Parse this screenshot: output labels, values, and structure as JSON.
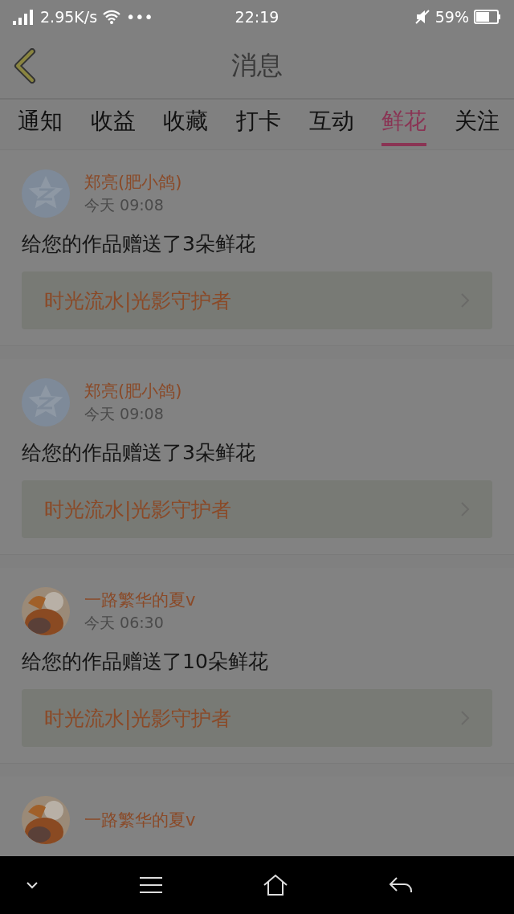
{
  "status_bar": {
    "speed": "2.95K/s",
    "more": "•••",
    "time": "22:19",
    "battery": "59%"
  },
  "header": {
    "title": "消息"
  },
  "tabs": [
    {
      "label": "通知",
      "selected": false
    },
    {
      "label": "收益",
      "selected": false
    },
    {
      "label": "收藏",
      "selected": false
    },
    {
      "label": "打卡",
      "selected": false
    },
    {
      "label": "互动",
      "selected": false
    },
    {
      "label": "鲜花",
      "selected": true
    },
    {
      "label": "关注",
      "selected": false
    }
  ],
  "messages": [
    {
      "kind": "default",
      "name": "郑亮(肥小鸽)",
      "time": "今天 09:08",
      "text": "给您的作品赠送了3朵鲜花",
      "work": "时光流水|光影守护者"
    },
    {
      "kind": "default",
      "name": "郑亮(肥小鸽)",
      "time": "今天 09:08",
      "text": "给您的作品赠送了3朵鲜花",
      "work": "时光流水|光影守护者"
    },
    {
      "kind": "picture",
      "name": "一路繁华的夏v",
      "time": "今天 06:30",
      "text": "给您的作品赠送了10朵鲜花",
      "work": "时光流水|光影守护者"
    },
    {
      "kind": "picture",
      "name": "一路繁华的夏v"
    }
  ]
}
